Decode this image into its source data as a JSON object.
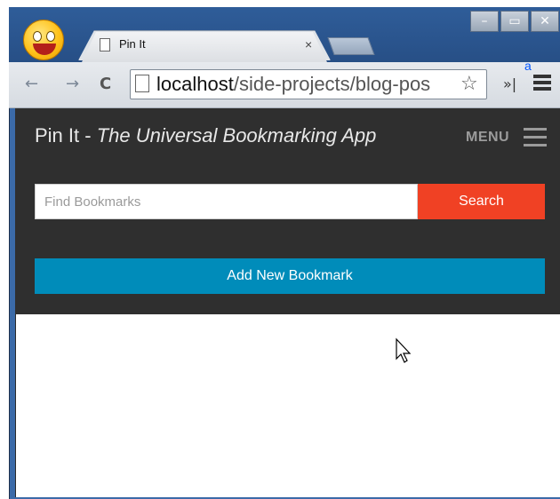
{
  "browser": {
    "tab_title": "Pin It",
    "tab_close_glyph": "×",
    "window_buttons": [
      "–",
      "▭",
      "✕"
    ],
    "url_host": "localhost",
    "url_path": "/side-projects/blog-pos",
    "extension_badge": "a",
    "icons": [
      "back-arrow-icon",
      "forward-arrow-icon",
      "reload-icon",
      "page-icon",
      "star-icon",
      "extensions-chevron-icon",
      "browser-menu-icon"
    ]
  },
  "app": {
    "title_prefix": "Pin It - ",
    "title_tagline": "The Universal Bookmarking App",
    "menu_label": "MENU",
    "search": {
      "placeholder": "Find Bookmarks",
      "value": "",
      "button_label": "Search"
    },
    "add_button_label": "Add New Bookmark"
  },
  "colors": {
    "header_bg": "#2f2f2f",
    "search_button": "#f04124",
    "add_button": "#008cba"
  }
}
